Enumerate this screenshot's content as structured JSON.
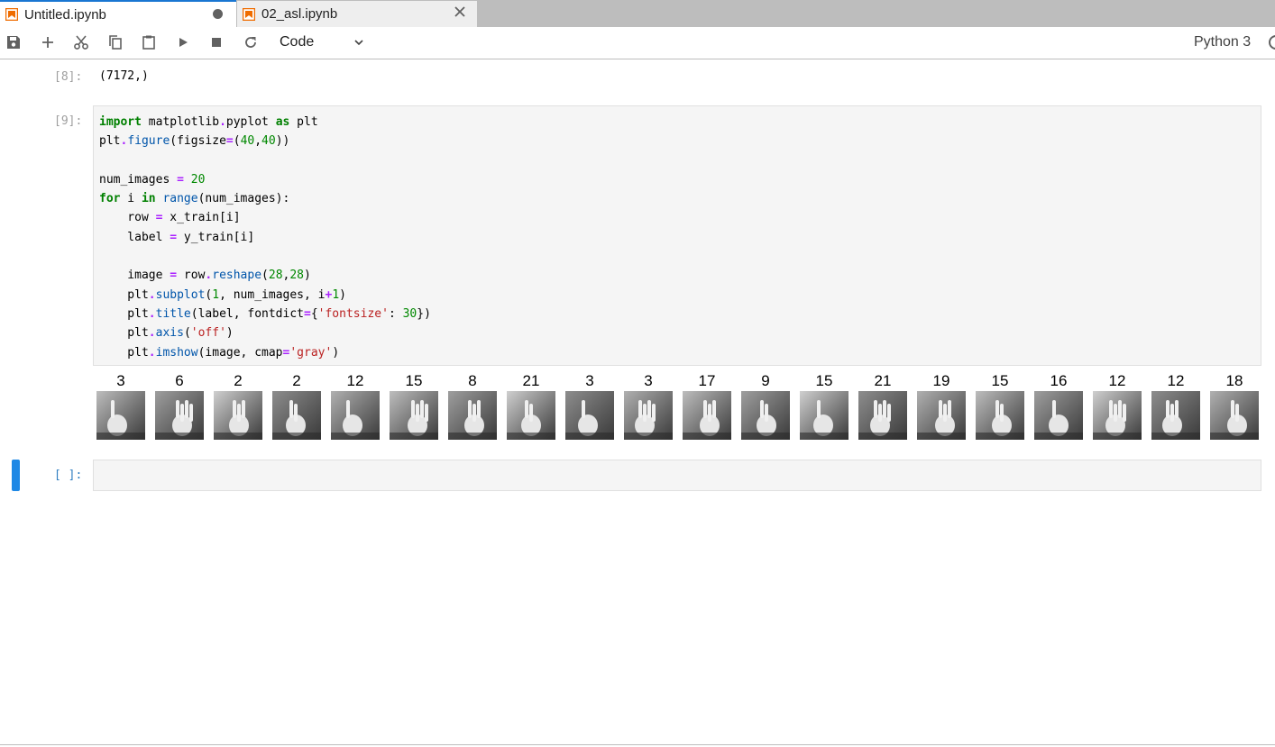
{
  "tabs": [
    {
      "label": "Untitled.ipynb",
      "active": true,
      "dirty": true
    },
    {
      "label": "02_asl.ipynb",
      "active": false,
      "dirty": false
    }
  ],
  "toolbar": {
    "buttons": [
      "save-icon",
      "add-icon",
      "cut-icon",
      "copy-icon",
      "paste-icon",
      "run-icon",
      "stop-icon",
      "restart-icon"
    ],
    "cell_type": "Code",
    "kernel_name": "Python 3"
  },
  "cells": {
    "output8": {
      "prompt": "[8]:",
      "text": "(7172,)"
    },
    "code9": {
      "prompt": "[9]:",
      "lines": [
        "import matplotlib.pyplot as plt",
        "plt.figure(figsize=(40,40))",
        "",
        "num_images = 20",
        "for i in range(num_images):",
        "    row = x_train[i]",
        "    label = y_train[i]",
        "",
        "    image = row.reshape(28,28)",
        "    plt.subplot(1, num_images, i+1)",
        "    plt.title(label, fontdict={'fontsize': 30})",
        "    plt.axis('off')",
        "    plt.imshow(image, cmap='gray')"
      ]
    },
    "figure_labels": [
      "3",
      "6",
      "2",
      "2",
      "12",
      "15",
      "8",
      "21",
      "3",
      "3",
      "17",
      "9",
      "15",
      "21",
      "19",
      "15",
      "16",
      "12",
      "12",
      "18"
    ],
    "empty": {
      "prompt": "[ ]:"
    }
  }
}
